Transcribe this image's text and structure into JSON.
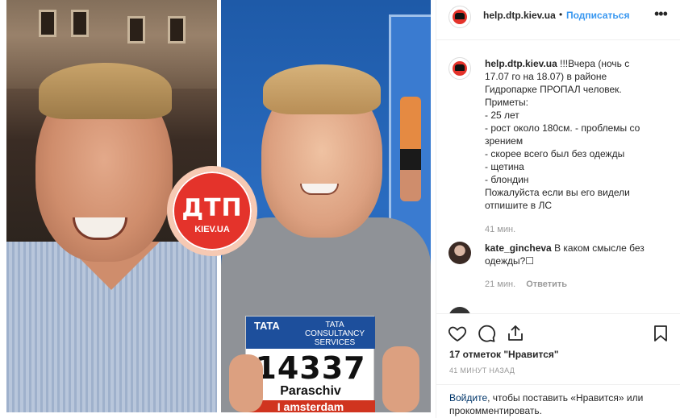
{
  "post": {
    "username": "help.dtp.kiev.ua",
    "header_separator": "•",
    "follow_label": "Подписаться",
    "more_label": "•••"
  },
  "photo": {
    "logo_main": "ДТП",
    "logo_sub": "KIEV.UA",
    "bib_brand": "TATA",
    "bib_sponsor": "TATA CONSULTANCY SERVICES",
    "bib_number": "14337",
    "bib_name": "Paraschiv",
    "bib_strip": "I amsterdam"
  },
  "caption": {
    "username": "help.dtp.kiev.ua",
    "lines": [
      "!!!Вчера (ночь с",
      "17.07 го на 18.07) в районе",
      "Гидропарке ПРОПАЛ человек.",
      "Приметы:",
      "- 25 лет",
      "- рост около 180см. - проблемы со",
      "зрением",
      "- скорее всего был без одежды",
      "- щетина",
      "- блондин",
      "Пожалуйста если вы его видели",
      "отпишите в ЛС"
    ],
    "time": "41 мин."
  },
  "comment": {
    "username": "kate_gincheva",
    "text_line1": "В каком смысле без",
    "text_line2": "одежды?☐",
    "time": "21 мин.",
    "reply_label": "Ответить"
  },
  "footer": {
    "likes": "17 отметок \"Нравится\"",
    "posted": "41 МИНУТ НАЗАД",
    "login_link": "Войдите",
    "login_text": ", чтобы поставить «Нравится» или прокомментировать."
  },
  "colors": {
    "accent": "#3897f0",
    "badge_red": "#e4332b"
  },
  "icons": [
    "heart-icon",
    "comment-icon",
    "share-icon",
    "bookmark-icon",
    "more-icon"
  ]
}
